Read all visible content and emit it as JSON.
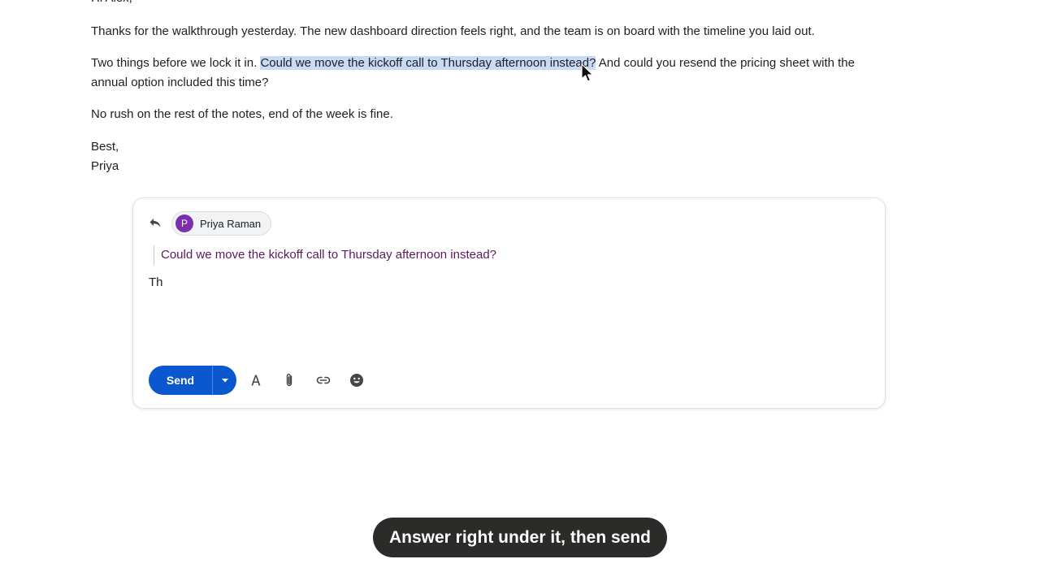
{
  "email": {
    "greeting": "Hi Alex,",
    "para1": "Thanks for the walkthrough yesterday. The new dashboard direction feels right, and the team is on board with the timeline you laid out.",
    "para2_before": "Two things before we lock it in. ",
    "para2_highlight": "Could we move the kickoff call to Thursday afternoon instead?",
    "para2_after": " And could you resend the pricing sheet with the annual option included this time?",
    "para3": "No rush on the rest of the notes, end of the week is fine.",
    "signoff": "Best,",
    "signature": "Priya"
  },
  "compose": {
    "recipient_name": "Priya Raman",
    "recipient_initial": "P",
    "quoted_text": "Could we move the kickoff call to Thursday afternoon instead?",
    "draft_text": "Th",
    "send_label": "Send"
  },
  "caption": "Answer right under it, then send",
  "colors": {
    "accent": "#0b57d0",
    "highlight": "#c8daf4",
    "avatar": "#7b2fae",
    "quote_text": "#5b1a57"
  },
  "icons": {
    "reply": "reply-icon",
    "send_more": "chevron-down-icon",
    "format": "text-format-icon",
    "attach": "paperclip-icon",
    "link": "link-icon",
    "emoji": "emoji-icon",
    "pointer": "mouse-pointer-icon"
  }
}
